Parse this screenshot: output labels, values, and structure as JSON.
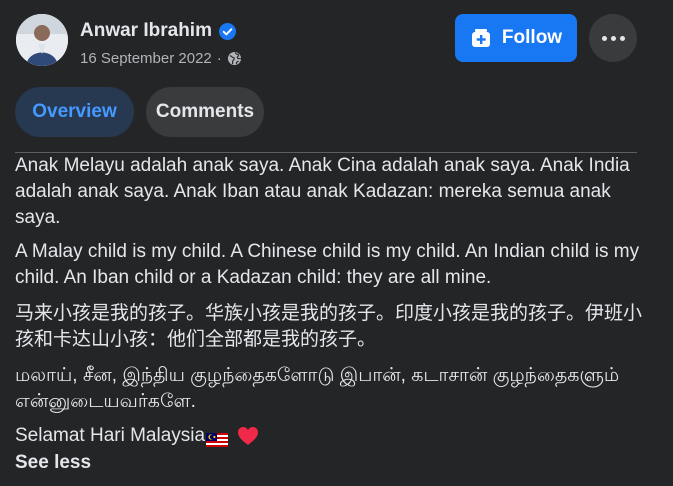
{
  "post": {
    "author_name": "Anwar Ibrahim",
    "date": "16 September 2022",
    "separator": "·",
    "follow_label": "Follow",
    "tabs": [
      {
        "label": "Overview",
        "active": true
      },
      {
        "label": "Comments",
        "active": false
      }
    ],
    "body": {
      "p1": "Anak Melayu adalah anak saya. Anak Cina adalah anak saya. Anak India adalah anak saya. Anak Iban atau anak Kadazan: mereka semua anak saya.",
      "p2": "A Malay child is my child. A Chinese child is my child. An Indian child is my child. An Iban child or a Kadazan child: they are all mine.",
      "p3": "马来小孩是我的孩子。华族小孩是我的孩子。印度小孩是我的孩子。伊班小孩和卡达山小孩：他们全部都是我的孩子。",
      "p4": "மலாய், சீன, இந்திய குழந்தைகளோடு இபான், கடாசான் குழந்தைகளும் என்னுடையவர்களே.",
      "greeting": "Selamat Hari Malaysia"
    },
    "see_less_label": "See less"
  },
  "colors": {
    "background": "#242526",
    "accent": "#1877f2",
    "tab_active_bg": "#263951",
    "tab_active_text": "#4599ff",
    "heart": "#f02849"
  },
  "icons": {
    "verified": "verified-badge-icon",
    "audience": "globe-icon",
    "follow": "follow-page-icon",
    "more": "more-options-icon",
    "flag": "malaysia-flag-emoji",
    "heart": "red-heart-emoji"
  }
}
